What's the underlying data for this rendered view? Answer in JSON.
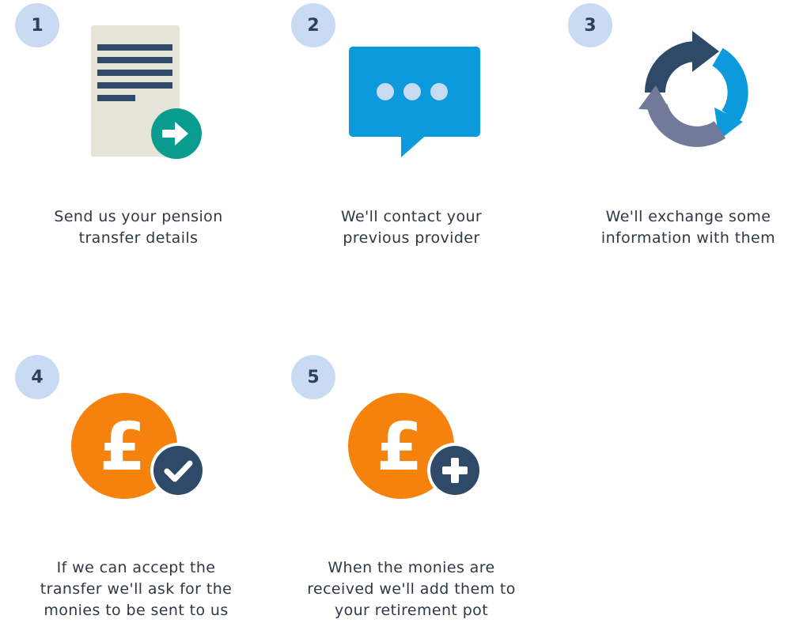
{
  "steps": [
    {
      "number": "1",
      "icon": "document-send-icon",
      "lines": [
        "Send us your pension",
        "transfer details"
      ]
    },
    {
      "number": "2",
      "icon": "chat-bubble-icon",
      "lines": [
        "We'll contact your",
        "previous provider"
      ]
    },
    {
      "number": "3",
      "icon": "exchange-cycle-icon",
      "lines": [
        "We'll exchange some",
        "information with them"
      ]
    },
    {
      "number": "4",
      "icon": "pound-check-icon",
      "lines": [
        "If we can accept the",
        "transfer we'll ask for the",
        "monies to be sent to us"
      ]
    },
    {
      "number": "5",
      "icon": "pound-add-icon",
      "lines": [
        "When the monies are",
        "received we'll add them to",
        "your retirement pot"
      ]
    }
  ],
  "colors": {
    "badge_bg": "#c9dbf2",
    "badge_text": "#2a4160",
    "navy": "#2e4a68",
    "blue": "#0b9adb",
    "teal": "#0a9d8f",
    "orange": "#f5820d",
    "paper": "#e6e3d8",
    "grey_purple": "#717a99",
    "text": "#2e3846"
  }
}
